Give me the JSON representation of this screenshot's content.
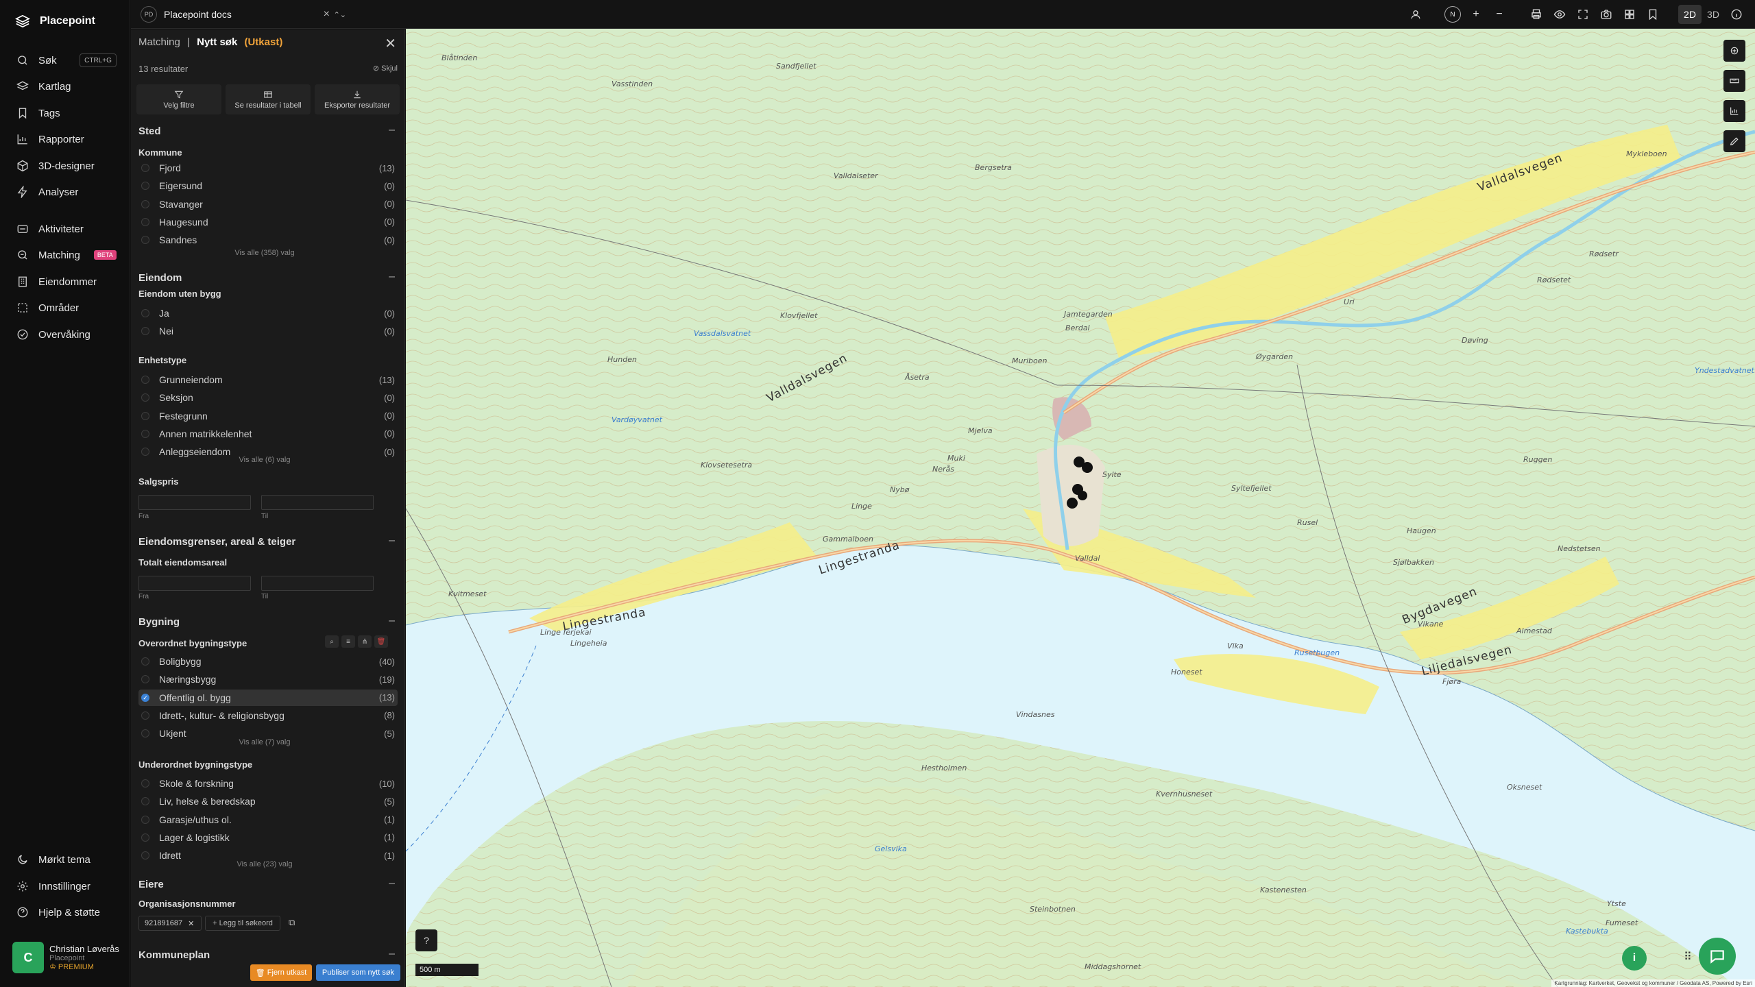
{
  "app": {
    "name": "Placepoint"
  },
  "nav": {
    "search": {
      "label": "Søk",
      "shortcut": "CTRL+G"
    },
    "items": [
      {
        "label": "Kartlag",
        "icon": "layers-icon"
      },
      {
        "label": "Tags",
        "icon": "bookmark-icon"
      },
      {
        "label": "Rapporter",
        "icon": "chart-icon"
      },
      {
        "label": "3D-designer",
        "icon": "cube-icon"
      },
      {
        "label": "Analyser",
        "icon": "bolt-icon"
      }
    ],
    "items2": [
      {
        "label": "Aktiviteter",
        "icon": "activity-icon"
      },
      {
        "label": "Matching",
        "icon": "match-icon",
        "badge": "BETA"
      },
      {
        "label": "Eiendommer",
        "icon": "building-icon"
      },
      {
        "label": "Områder",
        "icon": "area-icon"
      },
      {
        "label": "Overvåking",
        "icon": "monitor-icon"
      }
    ],
    "bottom": [
      {
        "label": "Mørkt tema",
        "icon": "moon-icon"
      },
      {
        "label": "Innstillinger",
        "icon": "gear-icon"
      },
      {
        "label": "Hjelp & støtte",
        "icon": "help-icon"
      }
    ],
    "profile": {
      "initial": "C",
      "name": "Christian Løverås",
      "org": "Placepoint",
      "tier": "PREMIUM"
    }
  },
  "topbar": {
    "workspace_badge": "PD",
    "workspace": "Placepoint docs",
    "compass": "N",
    "mode_2d": "2D",
    "mode_3d": "3D"
  },
  "panel": {
    "crumb_root": "Matching",
    "crumb_sep": "|",
    "crumb_title": "Nytt søk",
    "crumb_status": "(Utkast)",
    "results": "13 resultater",
    "hide": "Skjul",
    "actions": [
      "Velg filtre",
      "Se resultater i tabell",
      "Eksporter resultater"
    ],
    "sections": {
      "sted": "Sted",
      "eiendom": "Eiendom",
      "grenser": "Eiendomsgrenser, areal & teiger",
      "bygning": "Bygning",
      "eiere": "Eiere",
      "kommuneplan": "Kommuneplan"
    },
    "kommune": {
      "title": "Kommune",
      "rows": [
        {
          "label": "Fjord",
          "count": "(13)"
        },
        {
          "label": "Eigersund",
          "count": "(0)"
        },
        {
          "label": "Stavanger",
          "count": "(0)"
        },
        {
          "label": "Haugesund",
          "count": "(0)"
        },
        {
          "label": "Sandnes",
          "count": "(0)"
        }
      ],
      "show_all": "Vis alle (358) valg"
    },
    "uten_bygg": {
      "title": "Eiendom uten bygg",
      "rows": [
        {
          "label": "Ja",
          "count": "(0)"
        },
        {
          "label": "Nei",
          "count": "(0)"
        }
      ]
    },
    "enhetstype": {
      "title": "Enhetstype",
      "rows": [
        {
          "label": "Grunneiendom",
          "count": "(13)"
        },
        {
          "label": "Seksjon",
          "count": "(0)"
        },
        {
          "label": "Festegrunn",
          "count": "(0)"
        },
        {
          "label": "Annen matrikkelenhet",
          "count": "(0)"
        },
        {
          "label": "Anleggseiendom",
          "count": "(0)"
        }
      ],
      "show_all": "Vis alle (6) valg"
    },
    "salgspris": {
      "title": "Salgspris",
      "from": "Fra",
      "to": "Til"
    },
    "areal": {
      "title": "Totalt eiendomsareal",
      "from": "Fra",
      "to": "Til"
    },
    "overordnet": {
      "title": "Overordnet bygningstype",
      "rows": [
        {
          "label": "Boligbygg",
          "count": "(40)",
          "checked": false
        },
        {
          "label": "Næringsbygg",
          "count": "(19)",
          "checked": false
        },
        {
          "label": "Offentlig ol. bygg",
          "count": "(13)",
          "checked": true
        },
        {
          "label": "Idrett-, kultur- & religionsbygg",
          "count": "(8)",
          "checked": false
        },
        {
          "label": "Ukjent",
          "count": "(5)",
          "checked": false
        }
      ],
      "show_all": "Vis alle (7) valg"
    },
    "underordnet": {
      "title": "Underordnet bygningstype",
      "rows": [
        {
          "label": "Skole & forskning",
          "count": "(10)"
        },
        {
          "label": "Liv, helse & beredskap",
          "count": "(5)"
        },
        {
          "label": "Garasje/uthus ol.",
          "count": "(1)"
        },
        {
          "label": "Lager & logistikk",
          "count": "(1)"
        },
        {
          "label": "Idrett",
          "count": "(1)"
        }
      ],
      "show_all": "Vis alle (23) valg"
    },
    "orgnr": {
      "title": "Organisasjonsnummer",
      "chip": "921891687",
      "add": "Legg til søkeord"
    },
    "buttons": {
      "remove": "Fjern utkast",
      "publish": "Publiser som nytt søk"
    }
  },
  "map": {
    "roads": [
      "Valldalsvegen",
      "Valldalsvegen",
      "Lingestranda",
      "Lingestranda",
      "Bygdavegen",
      "Linge ferjekai",
      "Liljedalsvegen"
    ],
    "places": [
      "Blåtinden",
      "Sandfjellet",
      "Vasstinden",
      "Valldalseter",
      "Bergsetra",
      "Jamtegarden",
      "Berdal",
      "Muriboen",
      "Åsetra",
      "Klovfjellet",
      "Hunden",
      "Vassdalsvatnet",
      "Vardøyvatnet",
      "Klovsetesetra",
      "Nerås",
      "Nybø",
      "Linge",
      "Gammalboen",
      "Mjelva",
      "Muki",
      "Sylte",
      "Syltefjellet",
      "Valldal",
      "Rusel",
      "Haugen",
      "Uri",
      "Øygarden",
      "Døving",
      "Rødsetr",
      "Mykleboen",
      "Rødsetet",
      "Ruggen",
      "Sjølbakken",
      "Nedstetsen",
      "Yndestadvatnet",
      "Vikane",
      "Almestad",
      "Honeset",
      "Vika",
      "Rusetbugen",
      "Fjøra",
      "Vindasnes",
      "Hestholmen",
      "Kvernhusneset",
      "Gelsvika",
      "Steinbotnen",
      "Kastenesten",
      "Fumeset",
      "Kastebukta",
      "Oksneset",
      "Ytste",
      "Middagshornet",
      "Kvitmeset",
      "Lingeheia"
    ],
    "scale": "500 m",
    "attribution": "Kartgrunnlag: Kartverket, Geovekst og kommuner / Geodata AS, Powered by Esri"
  }
}
